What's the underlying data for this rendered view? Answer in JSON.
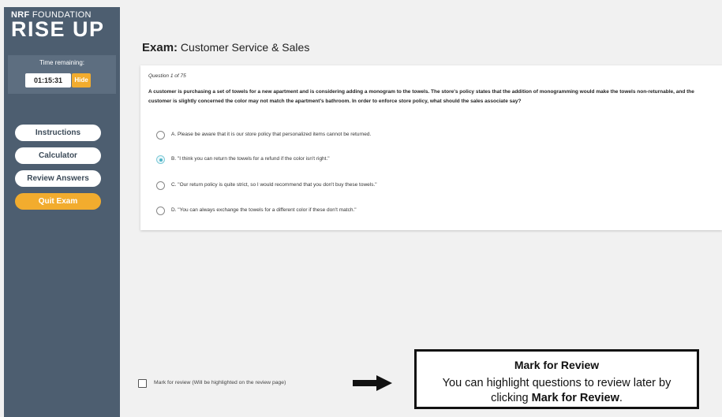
{
  "sidebar": {
    "brand_nrf": "NRF",
    "brand_foundation": "FOUNDATION",
    "brand_main": "RISE UP",
    "timer_label": "Time remaining:",
    "timer_value": "01:15:31",
    "hide_label": "Hide",
    "buttons": {
      "instructions": "Instructions",
      "calculator": "Calculator",
      "review_answers": "Review Answers",
      "quit_exam": "Quit Exam"
    }
  },
  "exam": {
    "title_prefix": "Exam:",
    "title_name": "Customer Service & Sales",
    "question_counter": "Question 1 of 75",
    "question_text": "A customer is purchasing a set of towels for a new apartment and is considering adding a monogram to the towels. The store's policy states that the addition of monogramming would make the towels non-returnable, and the customer is slightly concerned the color may not match the apartment's bathroom. In order to enforce store policy, what should the sales associate say?",
    "selected_option": "B",
    "options": [
      {
        "letter": "A",
        "text": "A. Please be aware that it is our store policy that personalized items cannot be returned."
      },
      {
        "letter": "B",
        "text": "B. \"I think you can return the towels for a refund if the color isn't right.\""
      },
      {
        "letter": "C",
        "text": "C. \"Our return policy is quite strict, so I would recommend that you don't buy these towels.\""
      },
      {
        "letter": "D",
        "text": "D. \"You can always exchange the towels for a different color if these don't match.\""
      }
    ],
    "mark_for_review_label": "Mark for review (Will be highlighted on the review page)",
    "mark_for_review_checked": false
  },
  "callout": {
    "title": "Mark for Review",
    "body_text": "You can highlight questions to review later by clicking",
    "body_bold": "Mark for Review",
    "body_end": "."
  },
  "colors": {
    "sidebar_bg": "#4d5e70",
    "accent_orange": "#f2ac2e",
    "radio_selected": "#4fb3c6",
    "page_bg": "#f1f1f1"
  }
}
